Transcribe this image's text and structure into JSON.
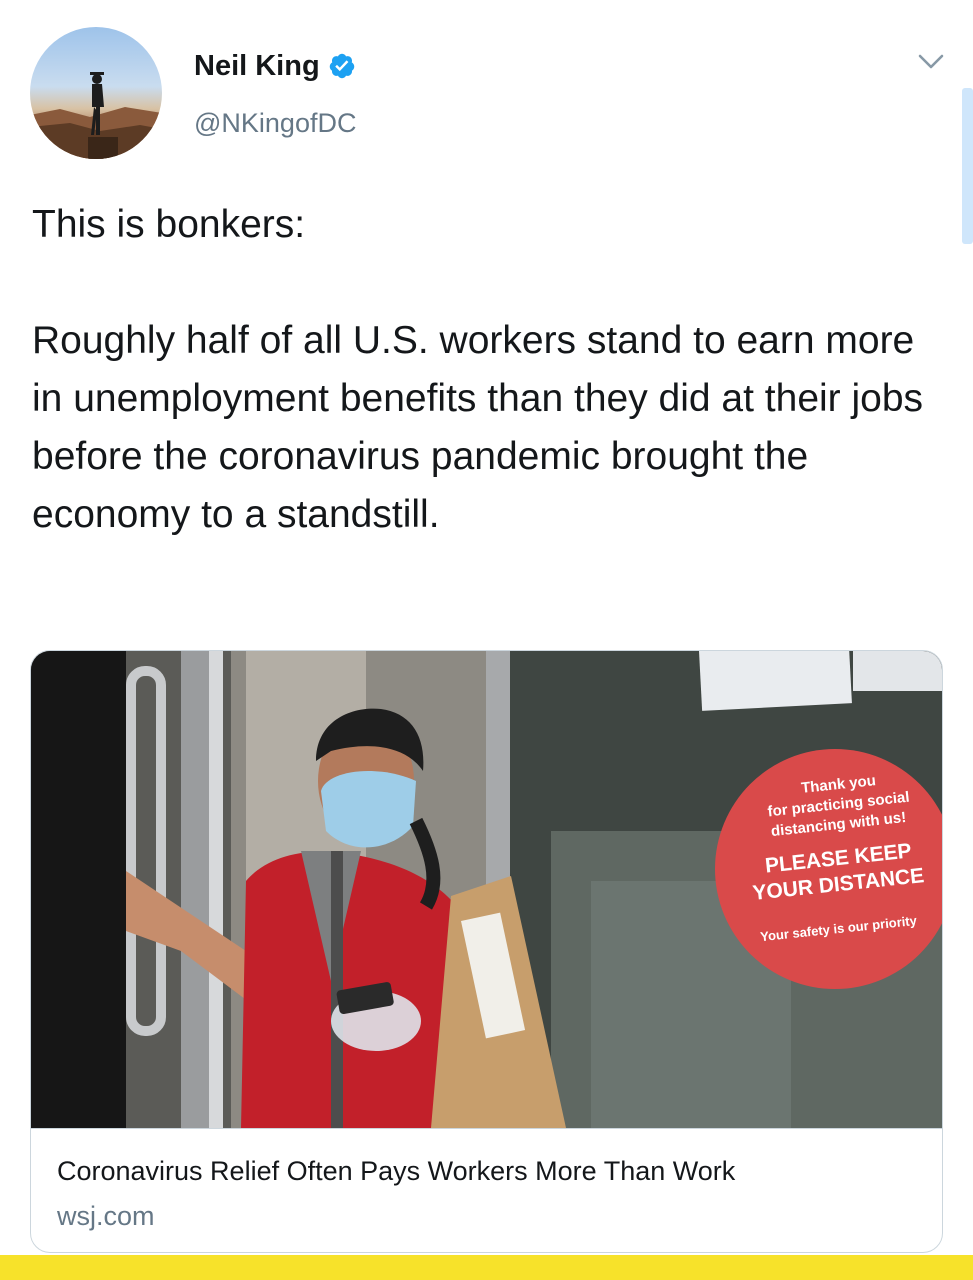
{
  "author": {
    "name": "Neil King",
    "handle": "@NKingofDC",
    "verified": true,
    "avatar_icon": "avatar-photo-person-on-canyon-ledge"
  },
  "tweet": {
    "text": "This is bonkers:\n\nRoughly half of all U.S. workers stand to earn more in unemployment benefits than they did at their jobs before the coronavirus pandemic brought the economy to a standstill."
  },
  "card": {
    "title": "Coronavirus Relief Often Pays Workers More Than Work",
    "domain": "wsj.com",
    "image": {
      "sign_line1": "Thank you",
      "sign_line2": "for practicing social",
      "sign_line3": "distancing with us!",
      "sign_line4": "PLEASE KEEP",
      "sign_line5": "YOUR DISTANCE",
      "sign_line6": "Your safety is our priority"
    }
  },
  "icons": {
    "verified": "verified-badge-icon",
    "menu": "chevron-down-icon"
  },
  "colors": {
    "text": "#14171a",
    "secondary": "#657786",
    "verified": "#1da1f2",
    "border": "#ccd6dd",
    "sign_red": "#d94a4a",
    "bottom_bar": "#f7e22a"
  }
}
